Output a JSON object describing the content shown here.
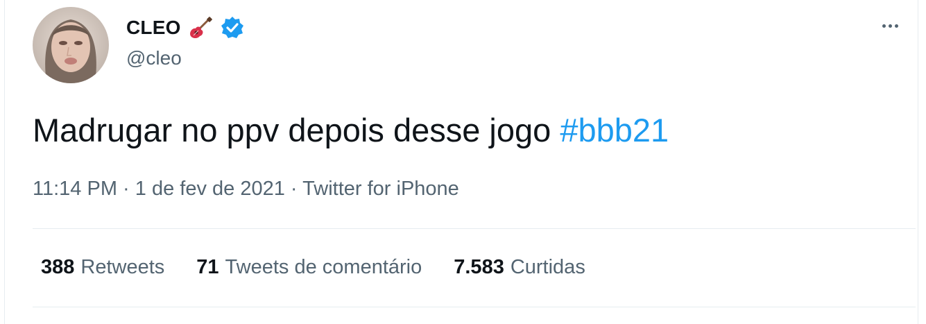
{
  "author": {
    "display_name": "CLEO",
    "name_emoji_icon": "guitar-icon",
    "verified_icon": "verified-badge-icon",
    "handle": "@cleo"
  },
  "tweet": {
    "text": "Madrugar no ppv depois desse jogo",
    "hashtag": "#bbb21"
  },
  "meta": {
    "time": "11:14 PM",
    "sep1": "·",
    "date": "1 de fev de 2021",
    "sep2": "·",
    "source": "Twitter for iPhone"
  },
  "stats": [
    {
      "count": "388",
      "label": "Retweets"
    },
    {
      "count": "71",
      "label": "Tweets de comentário"
    },
    {
      "count": "7.583",
      "label": "Curtidas"
    }
  ],
  "colors": {
    "accent": "#1d9bf0",
    "text": "#0f1419",
    "secondary": "#536471",
    "divider": "#e6ecf0"
  }
}
